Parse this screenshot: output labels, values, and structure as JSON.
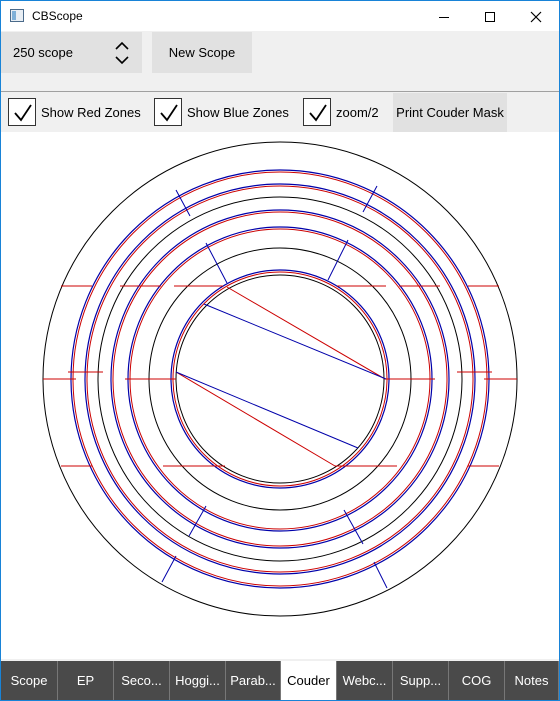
{
  "window": {
    "title": "CBScope"
  },
  "toolbar": {
    "scope_value": "250 scope",
    "new_scope_label": "New Scope"
  },
  "options": {
    "show_red_label": "Show Red Zones",
    "show_red_checked": true,
    "show_blue_label": "Show Blue Zones",
    "show_blue_checked": true,
    "zoom_label": "zoom/2",
    "zoom_checked": true,
    "print_label": "Print Couder Mask"
  },
  "colors": {
    "red": "#cc0000",
    "blue": "#0000aa",
    "tab_bg": "#4a4a4a"
  },
  "tabs": [
    {
      "label": "Scope",
      "active": false
    },
    {
      "label": "EP",
      "active": false
    },
    {
      "label": "Seco...",
      "active": false
    },
    {
      "label": "Hoggi...",
      "active": false
    },
    {
      "label": "Parab...",
      "active": false
    },
    {
      "label": "Couder",
      "active": true
    },
    {
      "label": "Webc...",
      "active": false
    },
    {
      "label": "Supp...",
      "active": false
    },
    {
      "label": "COG",
      "active": false
    },
    {
      "label": "Notes",
      "active": false
    }
  ]
}
